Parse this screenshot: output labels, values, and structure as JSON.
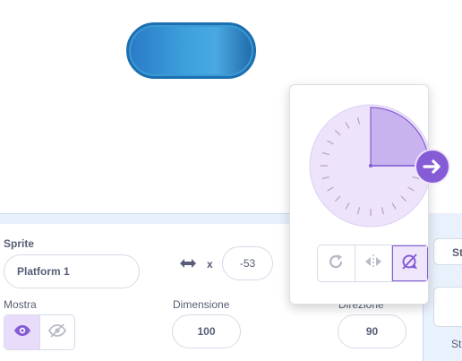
{
  "sprite_info": {
    "sprite_label": "Sprite",
    "sprite_name": "Platform 1",
    "x_label": "x",
    "x_value": "-53",
    "show_label": "Mostra",
    "size_label": "Dimensione",
    "size_value": "100",
    "direction_label": "Direzione",
    "direction_value": "90"
  },
  "right_panel": {
    "label_1": "St",
    "label_2": "St"
  },
  "direction_popover": {
    "direction_degrees": 90,
    "rotation_style": "left-right-off"
  },
  "colors": {
    "accent": "#855cd6",
    "text": "#575e75",
    "border": "#d5dbe6",
    "dial_bg": "#ede3fb",
    "wedge": "#c9b3ef"
  },
  "icons": [
    "arrows-left-right-icon",
    "eye-icon",
    "eye-slash-icon",
    "arrow-right-icon",
    "rotate-icon",
    "flip-horizontal-icon",
    "no-rotation-icon"
  ]
}
